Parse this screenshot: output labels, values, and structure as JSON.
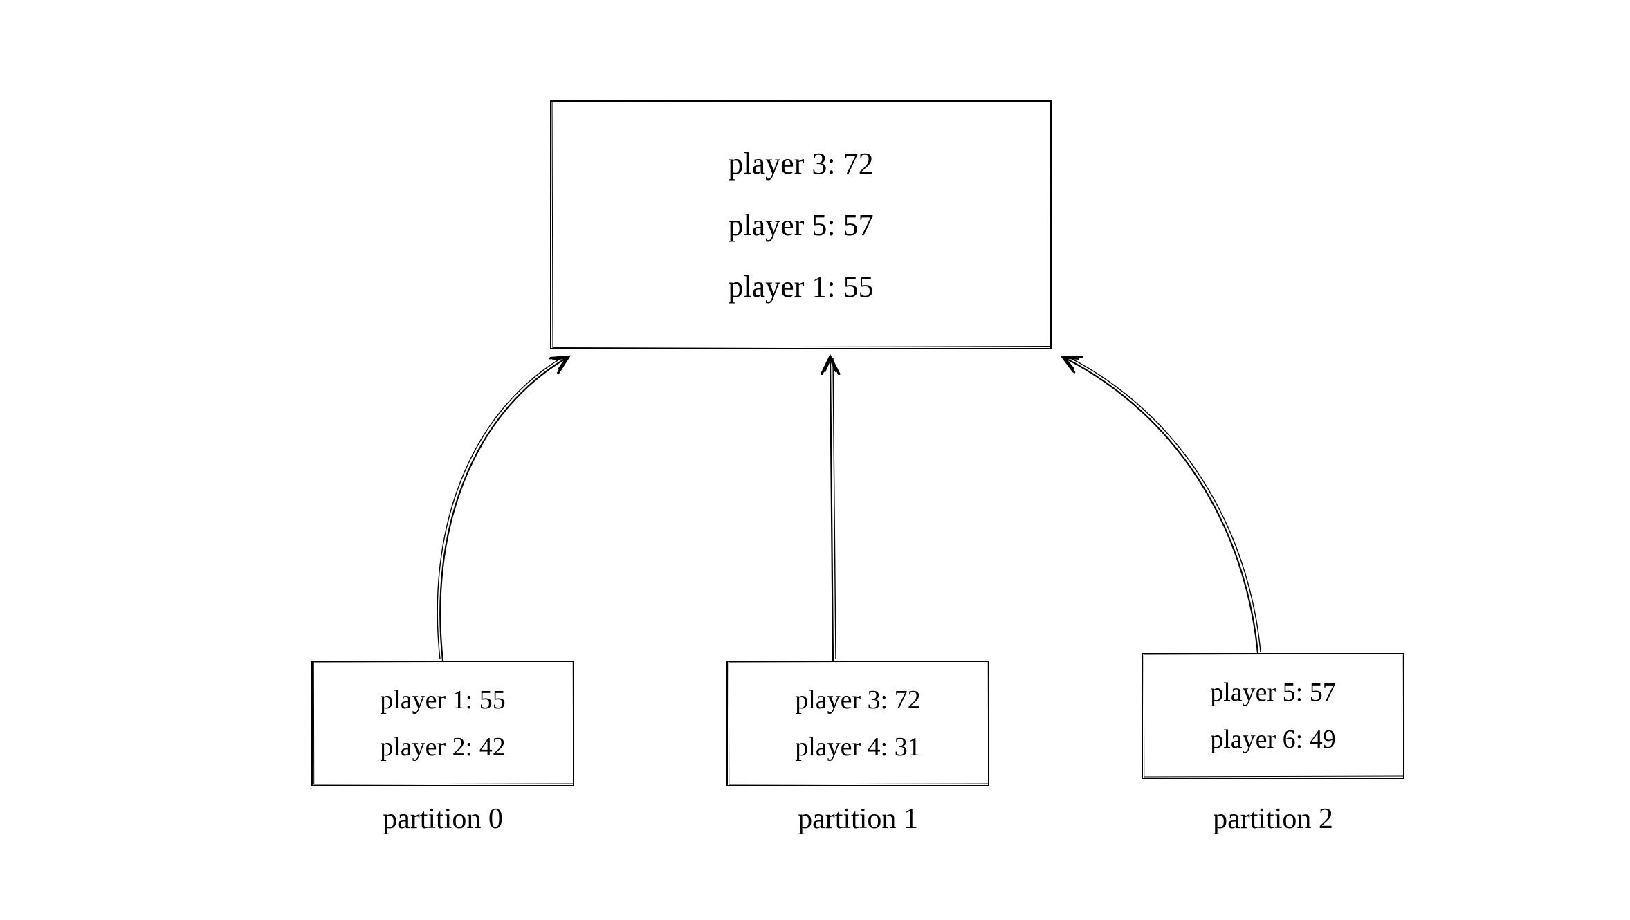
{
  "aggregated": {
    "rows": [
      {
        "label": "player 3:",
        "value": 72
      },
      {
        "label": "player 5:",
        "value": 57
      },
      {
        "label": "player 1:",
        "value": 55
      }
    ]
  },
  "partitions": [
    {
      "caption": "partition 0",
      "rows": [
        {
          "label": "player 1:",
          "value": 55
        },
        {
          "label": "player 2:",
          "value": 42
        }
      ]
    },
    {
      "caption": "partition 1",
      "rows": [
        {
          "label": "player 3:",
          "value": 72
        },
        {
          "label": "player 4:",
          "value": 31
        }
      ]
    },
    {
      "caption": "partition 2",
      "rows": [
        {
          "label": "player 5:",
          "value": 57
        },
        {
          "label": "player 6:",
          "value": 49
        }
      ]
    }
  ]
}
